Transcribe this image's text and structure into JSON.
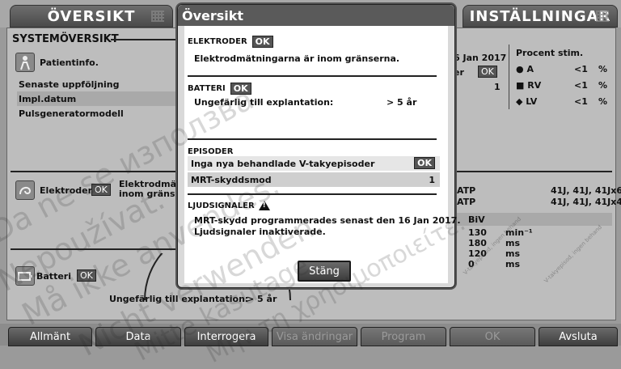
{
  "tabs": {
    "left": "ÖVERSIKT",
    "right": "INSTÄLLNINGAR"
  },
  "overview": {
    "title": "SYSTEMÖVERSIKT",
    "patient_button": "Patientinfo.",
    "rows": [
      "Senaste uppföljning",
      "Impl.datum",
      "Pulsgeneratormodell"
    ],
    "date_fragment": "6 Jan 2017",
    "er_fragment": "er",
    "ok_label": "OK",
    "count_fragment": "1",
    "pct_title": "Procent stim.",
    "pct_rows": [
      {
        "label": "A",
        "value": "<1",
        "unit": "%"
      },
      {
        "label": "RV",
        "value": "<1",
        "unit": "%"
      },
      {
        "label": "LV",
        "value": "<1",
        "unit": "%"
      }
    ],
    "leads_label": "Elektroder",
    "leads_text_1": "Elektrodmätr",
    "leads_text_2": "inom gränser",
    "atp_rows": [
      {
        "label": "ATP",
        "value": "41J, 41J, 41Jx6"
      },
      {
        "label": "ATP",
        "value": "41J, 41J, 41Jx4"
      }
    ],
    "biv_label": "BiV",
    "biv_values": [
      "130",
      "180",
      "120",
      "0"
    ],
    "biv_units": [
      "min⁻¹",
      "ms",
      "ms",
      "ms"
    ],
    "battery_label": "Batteri",
    "battery_text": "Ungefärlig till explantation:",
    "battery_value": "> 5 år"
  },
  "dialog": {
    "title": "Översikt",
    "leads_header": "ELEKTRODER",
    "leads_ok": "OK",
    "leads_text": "Elektrodmätningarna är inom gränserna.",
    "battery_header": "BATTERI",
    "battery_ok": "OK",
    "battery_text": "Ungefärlig till explantation:",
    "battery_value": "> 5 år",
    "episodes_header": "EPISODER",
    "episode_row1": "Inga nya behandlade V-takyepisoder",
    "episode_row1_ok": "OK",
    "episode_row2": "MRT-skyddsmod",
    "episode_row2_value": "1",
    "sound_header": "LJUDSIGNALER",
    "sound_text_1": "MRT-skydd programmerades senast den 16 Jan 2017.",
    "sound_text_2": "Ljudsignaler inaktiverade.",
    "close_label": "Stäng"
  },
  "bottom_bar": [
    "Allmänt",
    "Data",
    "Interrogera",
    "Visa ändringar",
    "Program",
    "OK",
    "Avsluta"
  ],
  "watermarks": [
    "Da ne se използва.",
    "Nepoužívat.",
    "Må ikke anvendes.",
    "Nicht verwenden.",
    "Mitte kasutage.",
    "Μην τη χρησιμοποιείτε."
  ],
  "small_watermarks": [
    "V-takyepisod, ingen behand",
    "V-takyepisod, ingen behand"
  ]
}
